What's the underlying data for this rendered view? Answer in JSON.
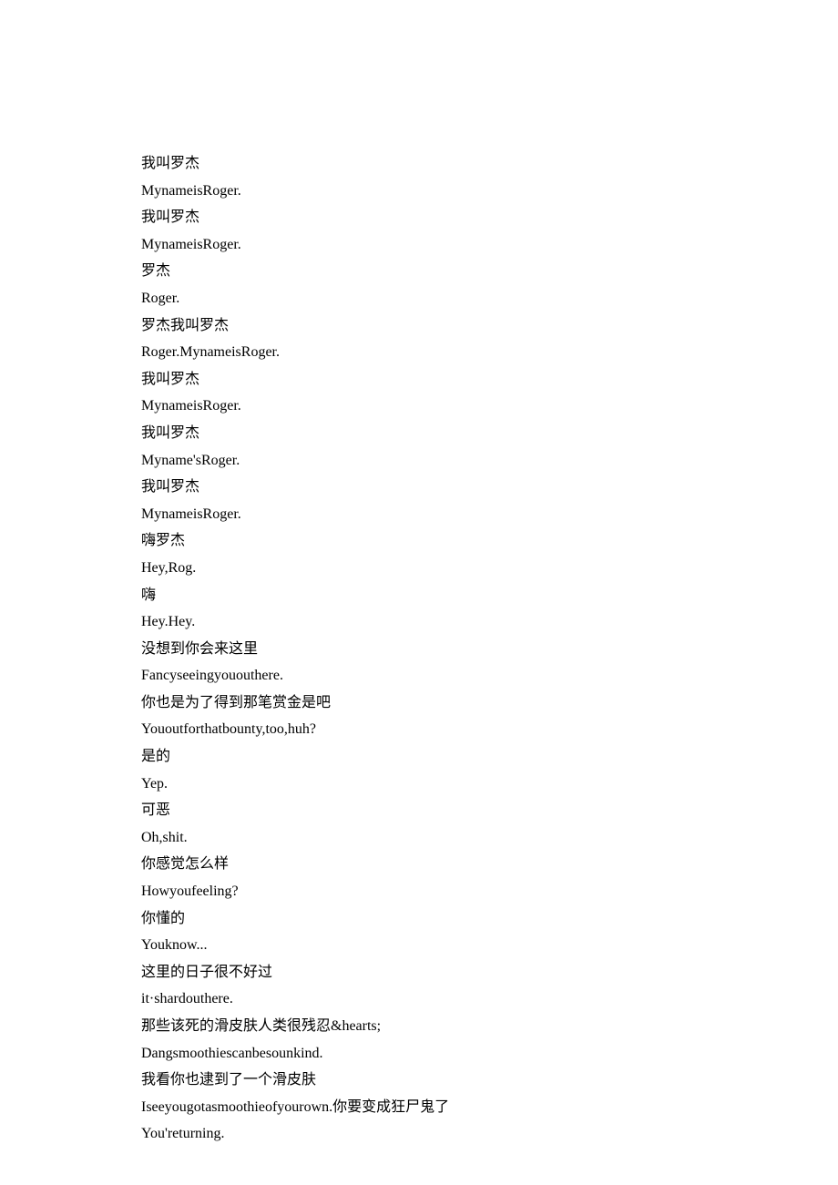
{
  "lines": [
    "我叫罗杰",
    "MynameisRoger.",
    "我叫罗杰",
    "MynameisRoger.",
    "罗杰",
    "Roger.",
    "罗杰我叫罗杰",
    "Roger.MynameisRoger.",
    "我叫罗杰",
    "MynameisRoger.",
    "我叫罗杰",
    "Myname'sRoger.",
    "我叫罗杰",
    "MynameisRoger.",
    "嗨罗杰",
    "Hey,Rog.",
    "嗨",
    "Hey.Hey.",
    "没想到你会来这里",
    "Fancyseeingyououthere.",
    "你也是为了得到那笔赏金是吧",
    "Yououtforthatbounty,too,huh?",
    "是的",
    "Yep.",
    "可恶",
    "Oh,shit.",
    "你感觉怎么样",
    "Howyoufeeling?",
    "你懂的",
    "Youknow...",
    "这里的日子很不好过",
    "it·shardouthere.",
    "那些该死的滑皮肤人类很残忍&hearts;",
    "Dangsmoothiescanbesounkind.",
    "我看你也逮到了一个滑皮肤",
    "Iseeyougotasmoothieofyourown.你要变成狂尸鬼了",
    "You'returning."
  ]
}
